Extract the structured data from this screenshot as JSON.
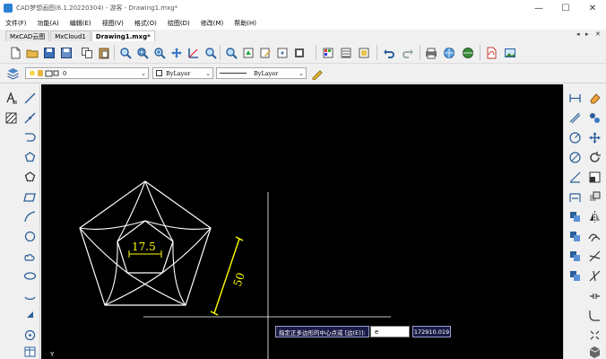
{
  "window": {
    "title": "CAD梦想画图(6.1.20220304) - 游客 - Drawing1.mxg*",
    "minimize": "—",
    "maximize": "☐",
    "close": "✕"
  },
  "menu": [
    "文件(F)",
    "功能(A)",
    "编辑(E)",
    "视图(V)",
    "格式(O)",
    "绘图(D)",
    "修改(M)",
    "帮助(H)"
  ],
  "tabs": [
    {
      "label": "MxCAD云图",
      "active": false
    },
    {
      "label": "MxCloud1",
      "active": false
    },
    {
      "label": "Drawing1.mxg*",
      "active": true
    }
  ],
  "tab_controls": {
    "left": "◂",
    "right": "▸",
    "close": "✕"
  },
  "layer_bar": {
    "layer_value": "0",
    "color_value": "ByLayer",
    "linetype_value": "ByLayer",
    "dropdown_arrow": "⌄"
  },
  "drawing": {
    "dimension_inner": "17.5",
    "dimension_side": "50"
  },
  "command": {
    "prompt": "指定正多边形的中心点或 [边(E)]:",
    "input_value": "e",
    "coordinate": "172910.019"
  },
  "colors": {
    "canvas": "#000000",
    "geometry": "#ffffff",
    "dimension": "#ffff00",
    "prompt_bg": "#1b1b47"
  },
  "ucs_label": "Y"
}
